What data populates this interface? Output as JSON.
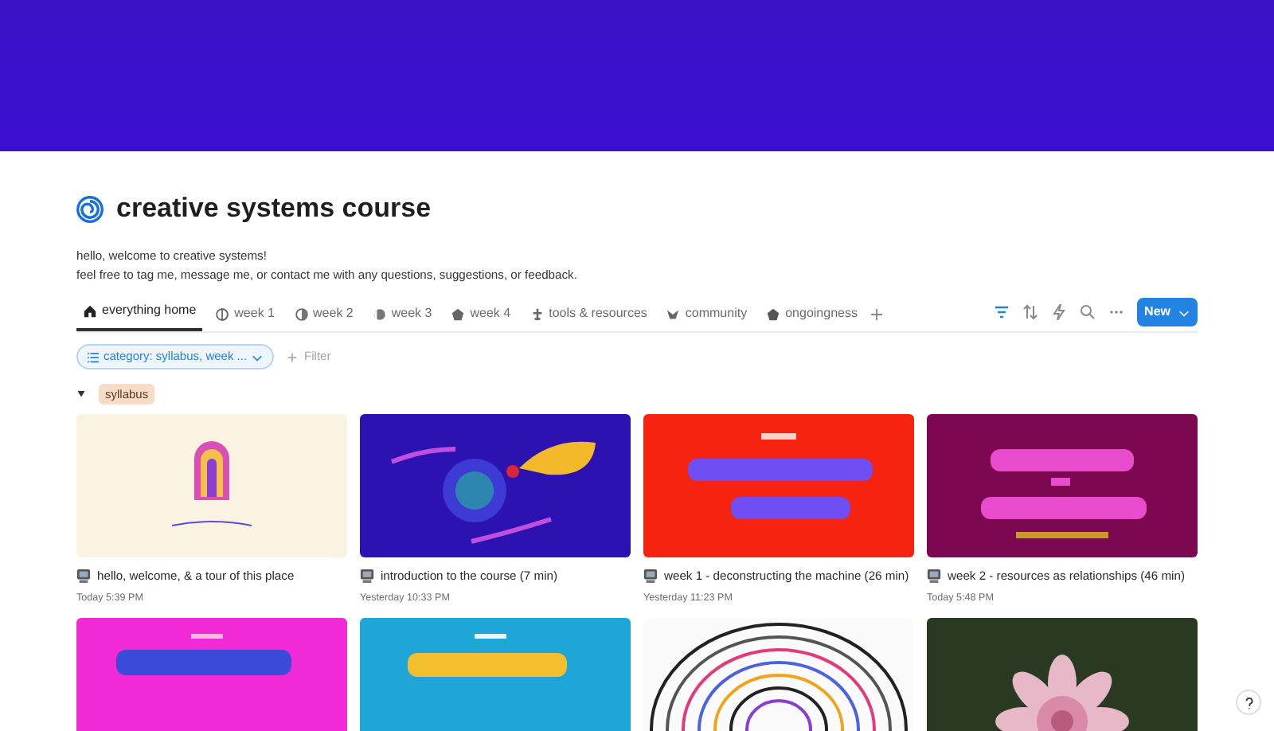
{
  "page": {
    "title": "creative systems course",
    "description": [
      "hello, welcome to creative systems!",
      "feel free to tag me, message me, or contact me with any questions, suggestions, or feedback."
    ]
  },
  "tabs": [
    {
      "label": "everything home",
      "selected": true
    },
    {
      "label": "week 1",
      "selected": false
    },
    {
      "label": "week 2",
      "selected": false
    },
    {
      "label": "week 3",
      "selected": false
    },
    {
      "label": "week 4",
      "selected": false
    },
    {
      "label": "tools & resources",
      "selected": false
    },
    {
      "label": "community",
      "selected": false
    },
    {
      "label": "ongoingness",
      "selected": false
    }
  ],
  "toolbar": {
    "filter_active": true,
    "new_button": "New"
  },
  "filter": {
    "chip": "category: syllabus, week ...",
    "add_label": "Filter"
  },
  "group": {
    "label": "syllabus",
    "expanded": true
  },
  "cards": [
    {
      "cover": {
        "kind": "picture"
      },
      "title": "hello, welcome, & a tour of this place",
      "date": "Today 5:39 PM"
    },
    {
      "cover": {
        "kind": "picture"
      },
      "title": "introduction to the course (7 min)",
      "date": "Yesterday 10:33 PM"
    },
    {
      "cover": {
        "kind": "picture"
      },
      "title": "week 1 - deconstructing the machine (26 min)",
      "date": "Yesterday 11:23 PM"
    },
    {
      "cover": {
        "kind": "picture"
      },
      "title": "week 2 - resources as relationships (46 min)",
      "date": "Today 5:48 PM"
    },
    {
      "cover": {
        "kind": "picture"
      }
    },
    {
      "cover": {
        "kind": "picture"
      }
    },
    {
      "cover": {
        "kind": "picture"
      }
    },
    {
      "cover": {
        "kind": "picture"
      }
    }
  ]
}
